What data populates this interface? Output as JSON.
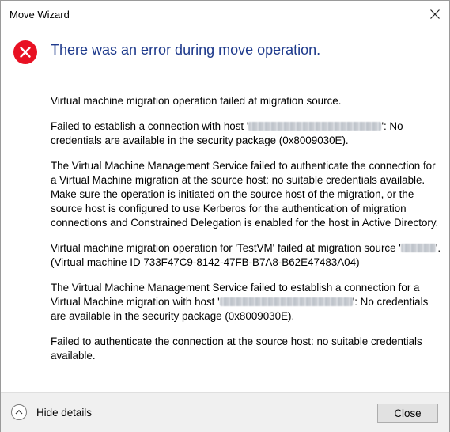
{
  "window": {
    "title": "Move Wizard",
    "close_icon": "close-x-icon"
  },
  "error": {
    "icon": "error-icon",
    "icon_color": "#e81123",
    "heading": "There was an error during move operation.",
    "heading_color": "#1e3a8c"
  },
  "message": {
    "p1": "Virtual machine migration operation failed at migration source.",
    "p2_before": "Failed to establish a connection with host '",
    "p2_after": "': No credentials are available in the security package (0x8009030E).",
    "p3": "The Virtual Machine Management Service failed to authenticate the connection for a Virtual Machine migration at the source host: no suitable credentials available. Make sure the operation is initiated on the source host of the migration, or the source host is configured to use Kerberos for the authentication of migration connections and Constrained Delegation is enabled for the host in Active Directory.",
    "p4_before": "Virtual machine migration operation for 'TestVM' failed at migration source '",
    "p4_after": "'. (Virtual machine ID 733F47C9-8142-47FB-B7A8-B62E47483A04)",
    "p5_before": "The Virtual Machine Management Service failed to establish a connection for a Virtual Machine migration with host '",
    "p5_after": "': No credentials are available in the security package (0x8009030E).",
    "p6": "Failed to authenticate the connection at the source host: no suitable credentials available."
  },
  "footer": {
    "details_label": "Hide details",
    "details_icon": "chevron-up-icon",
    "close_label": "Close"
  }
}
